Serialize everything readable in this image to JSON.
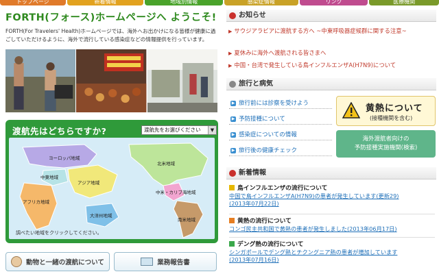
{
  "nav": {
    "tabs": [
      {
        "label": "トップページ",
        "color": "#e07a2a"
      },
      {
        "label": "新着情報",
        "color": "#e2a21f"
      },
      {
        "label": "地域別情報",
        "color": "#4aa32b"
      },
      {
        "label": "感染症情報",
        "color": "#c9a227"
      },
      {
        "label": "リンク",
        "color": "#c04c8f"
      },
      {
        "label": "医療機関",
        "color": "#7a9a2a"
      }
    ]
  },
  "welcome": {
    "title": "FORTH(フォース)ホームページへ ようこそ!",
    "intro": "FORTH(For Travelers' Health)ホームページでは、海外へお出かけになる皆様が健康に過ごしていただけるように、海外で流行している感染症などの情報提供を行っています。"
  },
  "destination": {
    "title": "渡航先はどちらですか?",
    "select_value": "渡航先をお選びください",
    "note": "調べたい地域をクリックしてください。",
    "regions": {
      "europe": "ヨーロッパ地域",
      "north_america": "北米地域",
      "middle_east": "中東地域",
      "asia": "アジア地域",
      "africa": "アフリカ地域",
      "oceania": "大洋州地域",
      "central_america": "中米・カリブ海地域",
      "south_america": "南米地域"
    }
  },
  "bottom_buttons": {
    "animals": "動物と一緒の渡航について",
    "report": "業務報告書"
  },
  "notices": {
    "title": "お知らせ",
    "items": [
      "サウジアラビアに渡航する方へ ~中東呼吸器症候群に関する注意~",
      "夏休みに海外へ渡航される皆さまへ",
      "中国・台湾で発生している鳥インフルエンザA(H7N9)について"
    ]
  },
  "travel": {
    "title": "旅行と病気",
    "links": [
      "旅行前には診察を受けよう",
      "予防接種について",
      "感染症についての情報",
      "旅行後の健康チェック"
    ],
    "yellow_fever_title": "黄熱について",
    "yellow_fever_sub": "(接種機関を含む)",
    "vaccination_line1": "海外渡航者向けの",
    "vaccination_line2": "予防接種実施機関(検索)"
  },
  "whats_new": {
    "title": "新着情報",
    "items": [
      {
        "head": "鳥インフルエンザの流行について",
        "body": "中国で鳥インフルエンザA(H7N9)の患者が発生しています(更新29)",
        "date": "(2013年07月22日)",
        "icon_color": "#e6b800"
      },
      {
        "head": "黄熱の流行について",
        "body": "コンゴ民主共和国で黄熱の患者が発生しました(2013年06月17日)",
        "date": "",
        "icon_color": "#e67e22"
      },
      {
        "head": "デング熱の流行について",
        "body": "シンガポールでデング熱とチクングニア熱の患者が増加しています",
        "date": "(2013年07月16日)",
        "icon_color": "#3aa84a"
      }
    ]
  }
}
